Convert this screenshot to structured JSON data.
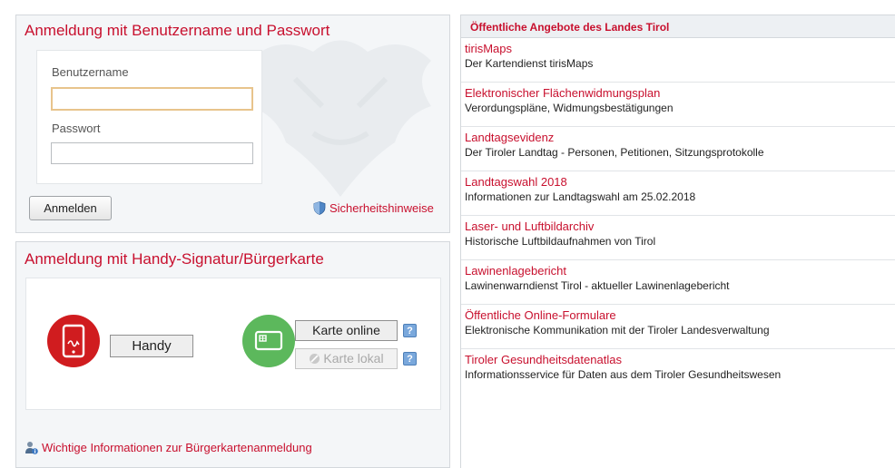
{
  "login": {
    "title": "Anmeldung mit Benutzername und Passwort",
    "username_label": "Benutzername",
    "username_value": "",
    "password_label": "Passwort",
    "password_value": "",
    "submit_label": "Anmelden",
    "security_link": "Sicherheitshinweise",
    "security_icon": "shield-icon"
  },
  "signatur": {
    "title": "Anmeldung mit Handy-Signatur/Bürgerkarte",
    "handy_icon": "mobile-phone-icon",
    "handy_label": "Handy",
    "card_icon": "smart-card-icon",
    "card_online_label": "Karte online",
    "card_local_label": "Karte lokal",
    "help_glyph": "?",
    "info_link": "Wichtige Informationen zur Bürgerkartenanmeldung",
    "info_icon": "person-info-icon"
  },
  "offers": {
    "title": "Öffentliche Angebote des Landes Tirol",
    "items": [
      {
        "title": "tirisMaps",
        "desc": "Der Kartendienst tirisMaps"
      },
      {
        "title": "Elektronischer Flächenwidmungsplan",
        "desc": "Verordungspläne, Widmungsbestätigungen"
      },
      {
        "title": "Landtagsevidenz",
        "desc": "Der Tiroler Landtag - Personen, Petitionen, Sitzungsprotokolle"
      },
      {
        "title": "Landtagswahl 2018",
        "desc": "Informationen zur Landtagswahl am 25.02.2018"
      },
      {
        "title": "Laser- und Luftbildarchiv",
        "desc": "Historische Luftbildaufnahmen von Tirol"
      },
      {
        "title": "Lawinenlagebericht",
        "desc": "Lawinenwarndienst Tirol - aktueller Lawinenlagebericht"
      },
      {
        "title": "Öffentliche Online-Formulare",
        "desc": "Elektronische Kommunikation mit der Tiroler Landesverwaltung"
      },
      {
        "title": "Tiroler Gesundheitsdatenatlas",
        "desc": "Informationsservice für Daten aus dem Tiroler Gesundheitswesen"
      }
    ]
  },
  "colors": {
    "accent": "#c8102e",
    "handy": "#d01c1f",
    "card": "#5cb85c",
    "panel": "#f4f6f8"
  }
}
